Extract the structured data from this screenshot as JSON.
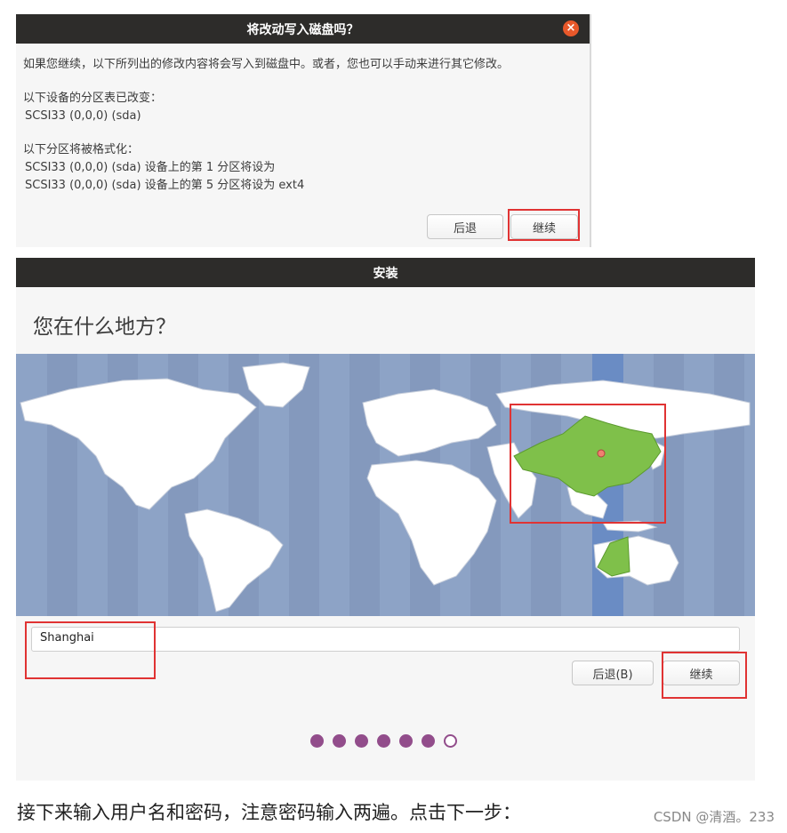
{
  "dialog": {
    "title": "将改动写入磁盘吗？",
    "close_icon": "×",
    "message": "如果您继续，以下所列出的修改内容将会写入到磁盘中。或者，您也可以手动来进行其它修改。",
    "partition_table_heading": "以下设备的分区表已改变：",
    "partition_table_device": "SCSI33 (0,0,0) (sda)",
    "format_heading": "以下分区将被格式化：",
    "format_items": [
      "SCSI33 (0,0,0) (sda) 设备上的第 1 分区将设为",
      "SCSI33 (0,0,0) (sda) 设备上的第 5 分区将设为 ext4"
    ],
    "back_label": "后退",
    "continue_label": "继续"
  },
  "installer": {
    "title": "安装",
    "question": "您在什么地方？",
    "location_value": "Shanghai",
    "back_label": "后退(B)",
    "continue_label": "继续",
    "progress": {
      "total": 7,
      "completed": 6
    }
  },
  "caption": "接下来输入用户名和密码，注意密码输入两遍。点击下一步：",
  "watermark": "CSDN @清酒。233",
  "colors": {
    "titlebar": "#2d2c2a",
    "close": "#e8582a",
    "ocean": "#8da3c6",
    "highlight_land": "#7fc04a",
    "timezone_band": "#6a8cc4",
    "progress_dot": "#924d8b",
    "annotation": "#e03333"
  }
}
